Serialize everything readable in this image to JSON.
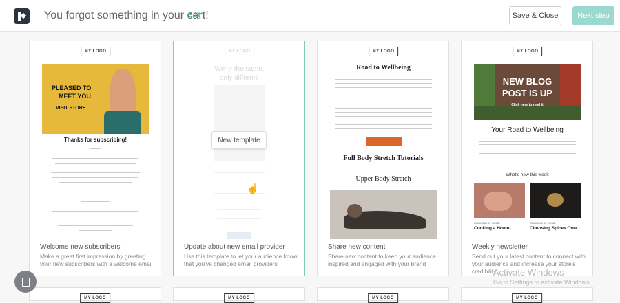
{
  "header": {
    "title": "You forgot something in your cart!",
    "edit_label": "Edit",
    "save_close_label": "Save & Close",
    "next_step_label": "Next step"
  },
  "logo_text": "MY LOGO",
  "cards": [
    {
      "title": "Welcome new subscribers",
      "desc": "Make a great first impression by greeting your new subscribers with a welcome email",
      "hero_line1": "PLEASED TO",
      "hero_line2": "MEET YOU",
      "hero_cta": "VISIT STORE",
      "heading": "Thanks for subscribing!"
    },
    {
      "title": "Update about new email provider",
      "desc": "Use this template to let your audience know that you've changed email providers",
      "heading1": "We're the same,",
      "heading2": "only different",
      "overlay_label": "New template"
    },
    {
      "title": "Share new content",
      "desc": "Share new content to keep your audience inspired and engaged with your brand",
      "heading": "Road to Wellbeing",
      "heading2": "Full Body Stretch Tutorials",
      "heading3": "Upper Body Stretch"
    },
    {
      "title": "Weekly newsletter",
      "desc": "Send out your latest content to connect with your audience and increase your store's credibility",
      "hero_line1": "NEW BLOG",
      "hero_line2": "POST IS UP",
      "hero_cta": "Click here to read it",
      "heading": "Your Road to Wellbeing",
      "section": "What's new this week",
      "item1_tag": "COOKING AT HOME",
      "item1_title": "Cooking a Home-",
      "item2_tag": "COOKING AT HOME",
      "item2_title": "Choosing Spices Over"
    }
  ],
  "watermark": {
    "line1": "Activate Windows",
    "line2": "Go to Settings to activate Windows."
  }
}
